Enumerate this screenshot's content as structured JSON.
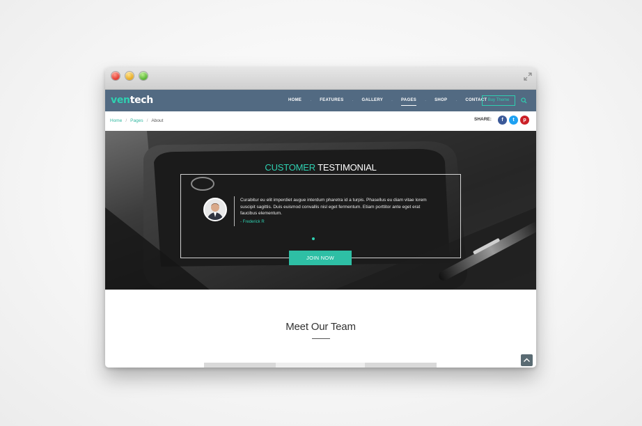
{
  "window": {
    "controls": [
      "close",
      "minimize",
      "maximize"
    ],
    "resize_icon": "expand-arrows-icon"
  },
  "navbar": {
    "logo_part1": "ven",
    "logo_part2": "tech",
    "menu": [
      "HOME",
      "FEATURES",
      "GALLERY",
      "PAGES",
      "SHOP",
      "CONTACT"
    ],
    "active": "PAGES",
    "buy_label": "Buy Theme",
    "search_icon": "search-icon"
  },
  "breadcrumb": {
    "items": [
      "Home",
      "Pages"
    ],
    "current": "About",
    "sep": "/"
  },
  "share": {
    "label": "SHARE:",
    "buttons": [
      {
        "name": "facebook",
        "glyph": "f",
        "color": "#3b5998"
      },
      {
        "name": "twitter",
        "glyph": "t",
        "color": "#1da1f2"
      },
      {
        "name": "pinterest",
        "glyph": "p",
        "color": "#cb2027"
      }
    ]
  },
  "hero": {
    "title_accent": "CUSTOMER",
    "title_rest": "TESTIMONIAL",
    "quote": "Curabitur eu elit imperdiet augue interdum pharetra id a turpis. Phasellus eu diam vitae lorem suscipit sagittis. Duis euismod convallis nisl eget fermentum. Etiam porttitor ante eget erat faucibus elementum.",
    "author": "- Frederick R",
    "cta": "JOIN NOW"
  },
  "team": {
    "title": "Meet Our Team"
  },
  "colors": {
    "accent": "#2fd0b1",
    "nav_bg": "#526a82",
    "cta_bg": "#2ebfa5"
  }
}
